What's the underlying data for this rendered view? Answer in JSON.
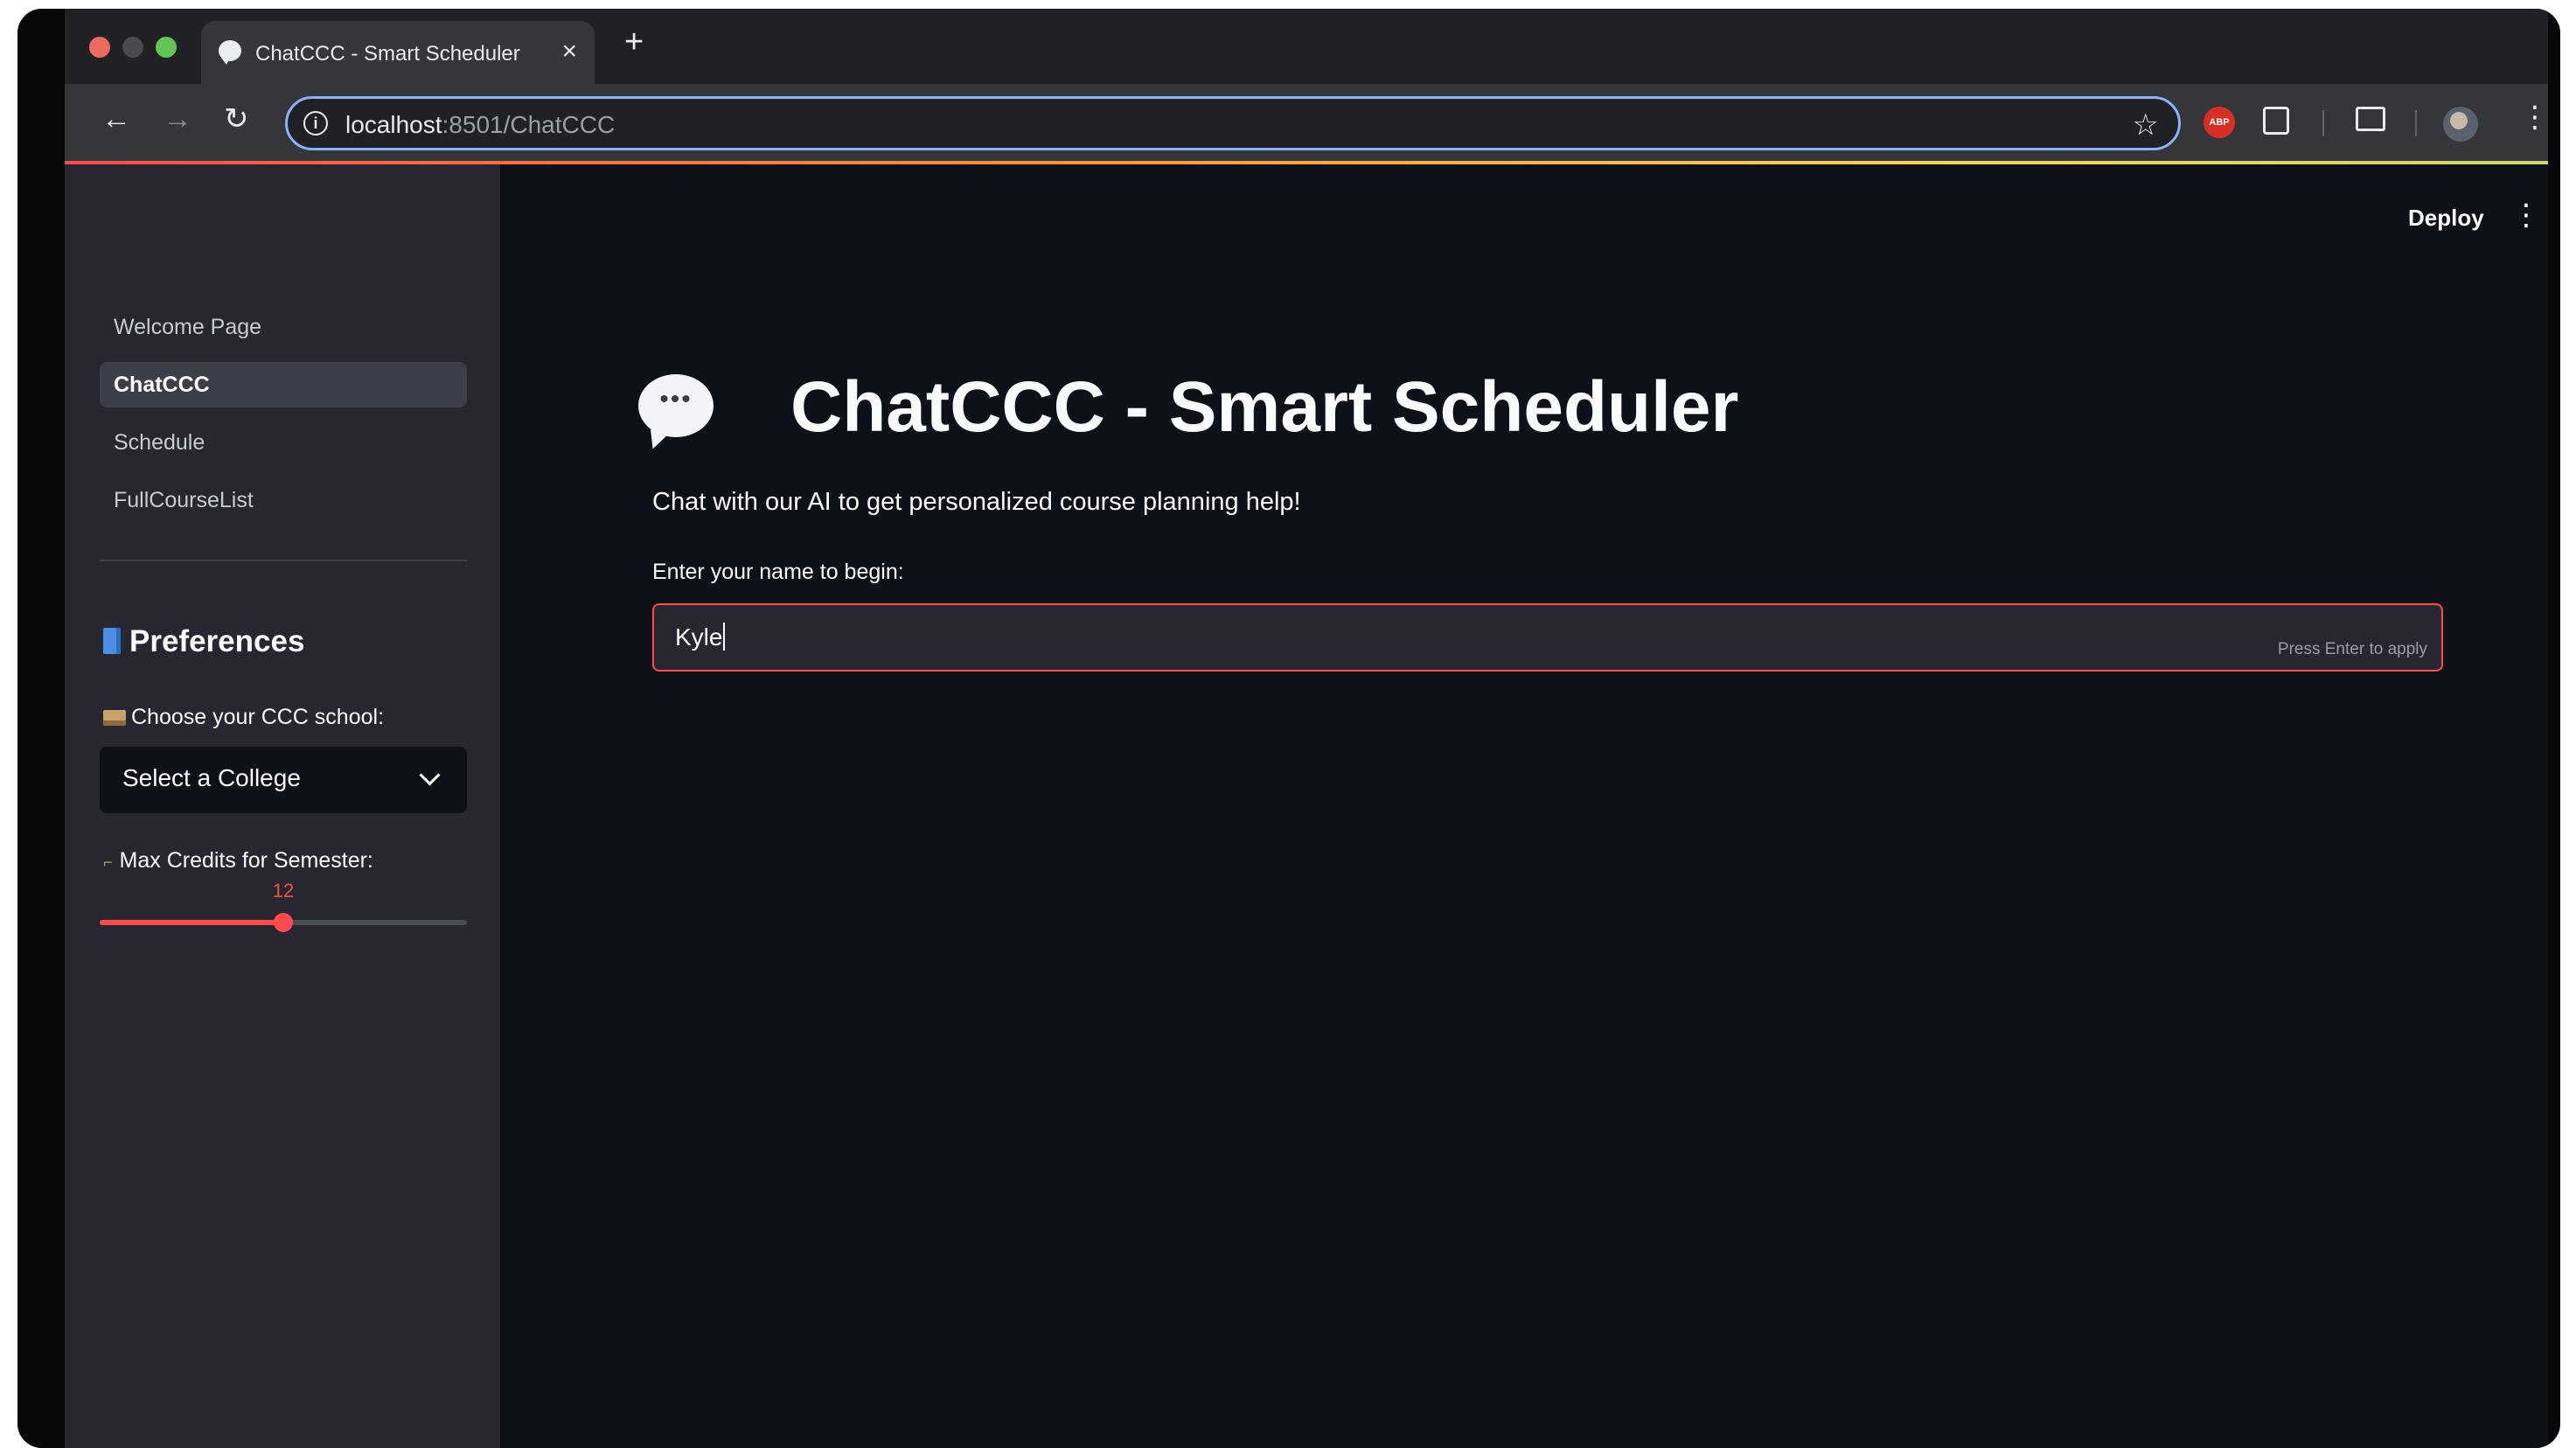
{
  "browser": {
    "tab_title": "ChatCCC - Smart Scheduler",
    "tab_close": "×",
    "new_tab": "+",
    "url_host": "localhost",
    "url_rest": ":8501/ChatCCC",
    "extension_abp": "ABP",
    "icons": {
      "back": "back-arrow-icon",
      "forward": "forward-arrow-icon",
      "reload": "reload-icon",
      "info": "site-info-icon",
      "star": "bookmark-star-icon",
      "menu": "kebab-menu-icon"
    }
  },
  "app": {
    "deploy_label": "Deploy",
    "menu_icon": "⋮"
  },
  "sidebar": {
    "nav_items": [
      {
        "label": "Welcome Page",
        "active": false
      },
      {
        "label": "ChatCCC",
        "active": true
      },
      {
        "label": "Schedule",
        "active": false
      },
      {
        "label": "FullCourseList",
        "active": false
      }
    ],
    "preferences_title": "Preferences",
    "school_label": "Choose your CCC school:",
    "school_select_value": "Select a College",
    "credits_label": "Max Credits for Semester:",
    "credits_value": "12",
    "credits_fraction": 0.5
  },
  "main": {
    "title": "ChatCCC - Smart Scheduler",
    "subtitle": "Chat with our AI to get personalized course planning help!",
    "name_label": "Enter your name to begin:",
    "name_value": "Kyle",
    "name_hint": "Press Enter to apply"
  },
  "colors": {
    "accent": "#ff4b4b",
    "background": "#0e1117",
    "sidebar": "#262730"
  }
}
